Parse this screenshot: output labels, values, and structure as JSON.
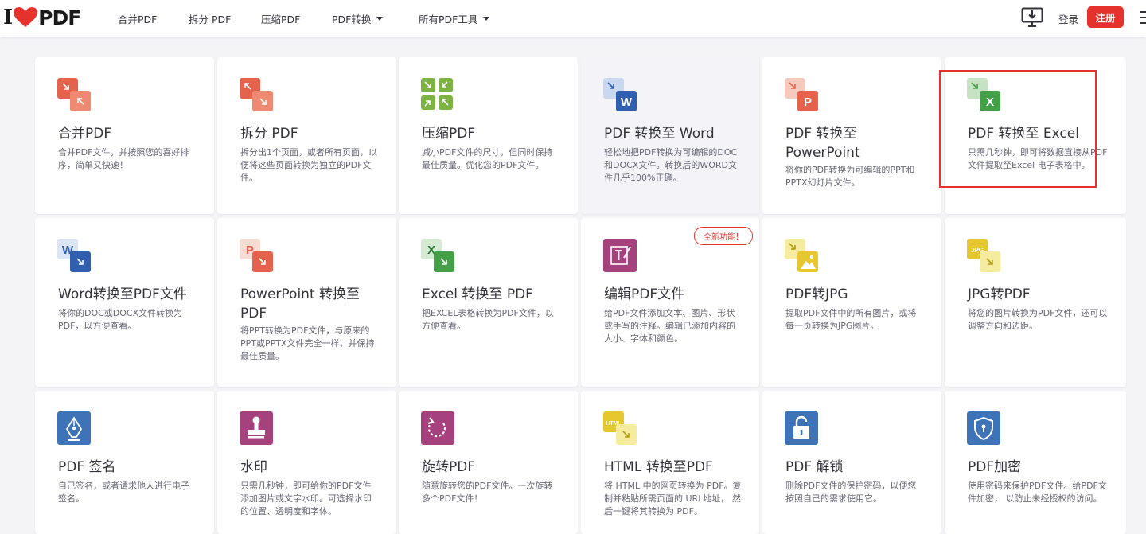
{
  "header": {
    "logo_i": "I",
    "logo_pdf": "PDF",
    "nav": [
      "合并PDF",
      "拆分 PDF",
      "压缩PDF",
      "PDF转换",
      "所有PDF工具"
    ],
    "login": "登录",
    "register": "注册"
  },
  "tools": [
    {
      "title": "合并PDF",
      "desc": "合并PDF文件，并按照您的喜好排序，简单又快速！",
      "icon": "merge-icon"
    },
    {
      "title": "拆分 PDF",
      "desc": "拆分出1个页面，或者所有页面，以便将这些页面转换为独立的PDF文件。",
      "icon": "split-icon"
    },
    {
      "title": "压缩PDF",
      "desc": "减小PDF文件的尺寸，但同时保持最佳质量。优化您的PDF文件。",
      "icon": "compress-icon"
    },
    {
      "title": "PDF 转换至 Word",
      "desc": "轻松地把PDF转换为可编辑的DOC和DOCX文件。转换后的WORD文件几乎100%正确。",
      "icon": "pdf-to-word-icon"
    },
    {
      "title": "PDF 转换至 PowerPoint",
      "desc": "将你的PDF转换为可编辑的PPT和PPTX幻灯片文件。",
      "icon": "pdf-to-ppt-icon"
    },
    {
      "title": "PDF 转换至 Excel",
      "desc": "只需几秒钟，即可将数据直接从PDF文件提取至Excel 电子表格中。",
      "icon": "pdf-to-excel-icon"
    },
    {
      "title": "Word转换至PDF文件",
      "desc": "将你的DOC或DOCX文件转换为PDF，以方便查看。",
      "icon": "word-to-pdf-icon"
    },
    {
      "title": "PowerPoint 转换至 PDF",
      "desc": "将PPT转换为PDF文件，与原来的PPT或PPTX文件完全一样，并保持最佳质量。",
      "icon": "ppt-to-pdf-icon"
    },
    {
      "title": "Excel 转换至 PDF",
      "desc": "把EXCEL表格转换为PDF文件，以方便查看。",
      "icon": "excel-to-pdf-icon"
    },
    {
      "title": "编辑PDF文件",
      "desc": "给PDF文件添加文本、图片、形状或手写的注释。编辑已添加内容的大小、字体和颜色。",
      "icon": "edit-pdf-icon",
      "badge": "全新功能！"
    },
    {
      "title": "PDF转JPG",
      "desc": "提取PDF文件中的所有图片，或将每一页转换为JPG图片。",
      "icon": "pdf-to-jpg-icon"
    },
    {
      "title": "JPG转PDF",
      "desc": "将您的图片转换为PDF文件，还可以调整方向和边距。",
      "icon": "jpg-to-pdf-icon"
    },
    {
      "title": "PDF 签名",
      "desc": "自己签名，或者请求他人进行电子签名。",
      "icon": "sign-pdf-icon"
    },
    {
      "title": "水印",
      "desc": "只需几秒钟，即可给你的PDF文件添加图片或文字水印。可选择水印的位置、透明度和字体。",
      "icon": "watermark-icon"
    },
    {
      "title": "旋转PDF",
      "desc": "随意旋转您的PDF文件。一次旋转多个PDF文件！",
      "icon": "rotate-pdf-icon"
    },
    {
      "title": "HTML 转换至PDF",
      "desc": "将 HTML 中的网页转换为 PDF。复制并粘贴所需页面的 URL地址， 然后一键将其转换为 PDF。",
      "icon": "html-to-pdf-icon"
    },
    {
      "title": "PDF 解锁",
      "desc": "删除PDF文件的保护密码，以便您按照自己的需求使用它。",
      "icon": "unlock-pdf-icon"
    },
    {
      "title": "PDF加密",
      "desc": "使用密码来保护PDF文件。给PDF文件加密， 以防止未经授权的访问。",
      "icon": "protect-pdf-icon"
    }
  ],
  "icon_text": {
    "word": "W",
    "ppt": "P",
    "excel": "X",
    "jpg": "JPG",
    "html": "HTML"
  },
  "colors": {
    "brand_red": "#e5322d",
    "merge": "#e5634c",
    "compress": "#7cb342",
    "word": "#2f5fae",
    "ppt": "#e5634c",
    "excel": "#43a047",
    "edit": "#a5427e",
    "jpg": "#e6c72f",
    "sign": "#3e74b7",
    "watermark": "#a5427e",
    "rotate": "#a5427e",
    "lock": "#3e74b7"
  }
}
